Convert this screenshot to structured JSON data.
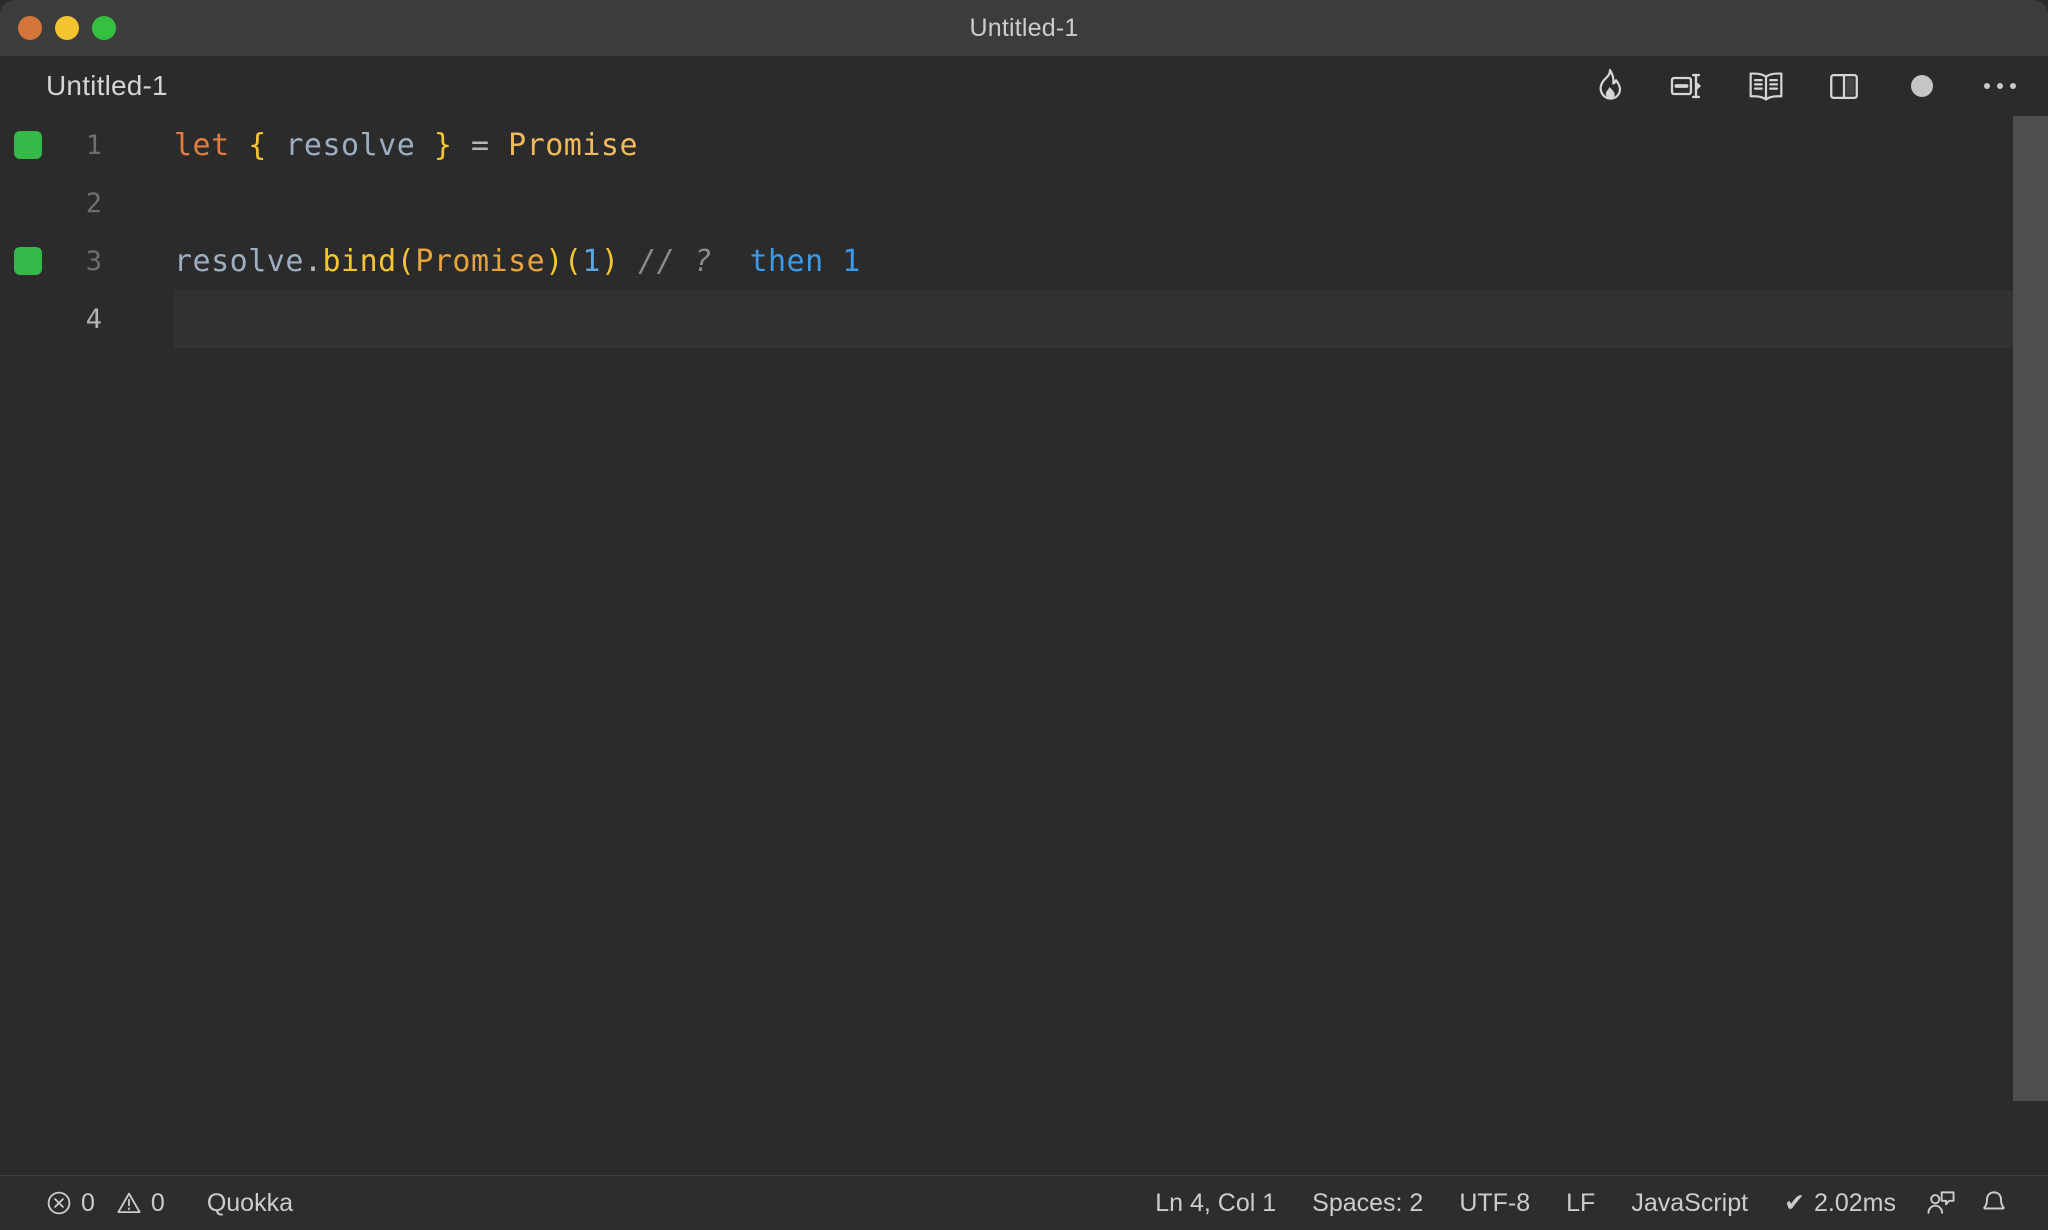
{
  "window": {
    "title": "Untitled-1",
    "traffic_lights": [
      "close-button",
      "minimize-button",
      "maximize-button"
    ]
  },
  "tabbar": {
    "tab_label": "Untitled-1",
    "actions": [
      {
        "name": "quokka-flame-icon",
        "tooltip": "Quokka"
      },
      {
        "name": "split-editor-right-icon",
        "tooltip": "Split Editor Right"
      },
      {
        "name": "open-preview-icon",
        "tooltip": "Open Preview"
      },
      {
        "name": "split-editor-icon",
        "tooltip": "Split Editor"
      },
      {
        "name": "record-dot-icon",
        "tooltip": "Record"
      },
      {
        "name": "more-actions-icon",
        "tooltip": "More Actions..."
      }
    ]
  },
  "editor": {
    "language": "JavaScript",
    "lines": [
      {
        "number": "1",
        "gutter": "covered",
        "current": false,
        "tokens": [
          {
            "text": "let",
            "cls": "tok-keyword"
          },
          {
            "text": " ",
            "cls": "tok-operator"
          },
          {
            "text": "{",
            "cls": "tok-brace"
          },
          {
            "text": " ",
            "cls": "tok-operator"
          },
          {
            "text": "resolve",
            "cls": "tok-var"
          },
          {
            "text": " ",
            "cls": "tok-operator"
          },
          {
            "text": "}",
            "cls": "tok-brace"
          },
          {
            "text": " ",
            "cls": "tok-operator"
          },
          {
            "text": "=",
            "cls": "tok-operator"
          },
          {
            "text": " ",
            "cls": "tok-operator"
          },
          {
            "text": "Promise",
            "cls": "tok-class"
          }
        ]
      },
      {
        "number": "2",
        "gutter": "none",
        "current": false,
        "tokens": []
      },
      {
        "number": "3",
        "gutter": "covered",
        "current": false,
        "tokens": [
          {
            "text": "resolve",
            "cls": "tok-var"
          },
          {
            "text": ".",
            "cls": "tok-operator"
          },
          {
            "text": "bind",
            "cls": "tok-func"
          },
          {
            "text": "(",
            "cls": "tok-punct"
          },
          {
            "text": "Promise",
            "cls": "tok-param"
          },
          {
            "text": ")",
            "cls": "tok-punct"
          },
          {
            "text": "(",
            "cls": "tok-punct"
          },
          {
            "text": "1",
            "cls": "tok-number"
          },
          {
            "text": ")",
            "cls": "tok-punct"
          },
          {
            "text": " ",
            "cls": "tok-operator"
          },
          {
            "text": "// ?",
            "cls": "tok-comment"
          },
          {
            "text": "  ",
            "cls": "tok-operator"
          },
          {
            "text": "then 1",
            "cls": "tok-quokka"
          }
        ]
      },
      {
        "number": "4",
        "gutter": "none",
        "current": true,
        "tokens": []
      }
    ]
  },
  "statusbar": {
    "errors_count": "0",
    "warnings_count": "0",
    "quokka_label": "Quokka",
    "cursor_position": "Ln 4, Col 1",
    "indentation": "Spaces: 2",
    "encoding": "UTF-8",
    "eol": "LF",
    "language_mode": "JavaScript",
    "run_time": "2.02ms",
    "run_time_check": "✔",
    "feedback_icon": "feedback-person-icon",
    "notifications_icon": "bell-icon"
  },
  "colors": {
    "titlebar_bg": "#3c3c3c",
    "editor_bg": "#2b2b2b",
    "statusbar_bg": "#2d2d2d",
    "current_line_bg": "#323232",
    "coverage_green": "#34b948",
    "quokka_blue": "#3d9ae8",
    "scrollbar": "#4e4e4e"
  }
}
